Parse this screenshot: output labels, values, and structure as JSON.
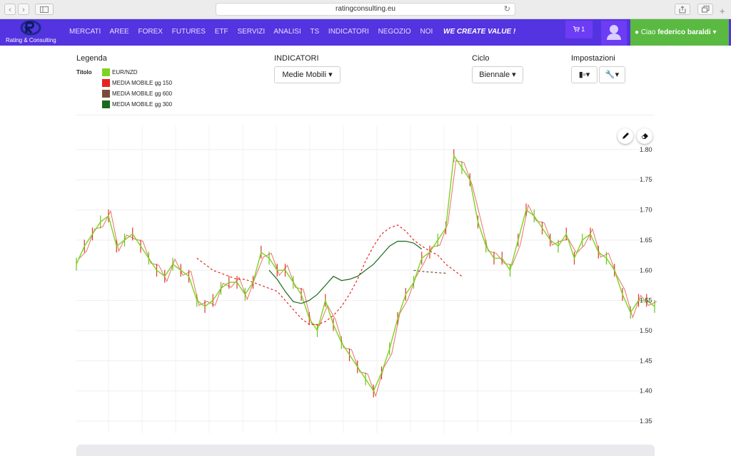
{
  "browser": {
    "url": "ratingconsulting.eu",
    "back_glyph": "‹",
    "forward_glyph": "›"
  },
  "nav": {
    "logo_text": "Rating & Consulting",
    "menu": [
      "MERCATI",
      "AREE",
      "FOREX",
      "FUTURES",
      "ETF",
      "SERVIZI",
      "ANALISI",
      "TS",
      "INDICATORI",
      "NEGOZIO",
      "NOI"
    ],
    "slogan": "WE CREATE VALUE !",
    "cart_count": "1",
    "user_greeting": "Ciao",
    "user_name": "federico baraldi",
    "brand_color": "#5433e0",
    "user_color": "#5ab941"
  },
  "controls": {
    "legenda_label": "Legenda",
    "titolo_label": "Titolo",
    "legend": [
      {
        "label": "EUR/NZD",
        "color": "#7ed321"
      },
      {
        "label": "MEDIA MOBILE gg 150",
        "color": "#e8231f"
      },
      {
        "label": "MEDIA MOBILE gg 600",
        "color": "#7b4b3a"
      },
      {
        "label": "MEDIA MOBILE gg 300",
        "color": "#1a6a1a"
      }
    ],
    "indicatori_label": "INDICATORI",
    "indicatori_value": "Medie Mobili",
    "ciclo_label": "Ciclo",
    "ciclo_value": "Biennale",
    "impostazioni_label": "Impostazioni"
  },
  "chart_data": {
    "type": "line",
    "yticks": [
      1.8,
      1.75,
      1.7,
      1.65,
      1.6,
      1.55,
      1.5,
      1.45,
      1.4,
      1.35
    ],
    "ylim": [
      1.33,
      1.84
    ],
    "grid": true,
    "series": [
      {
        "name": "EUR/NZD",
        "color": "#7ed321",
        "values": [
          1.61,
          1.64,
          1.66,
          1.68,
          1.69,
          1.64,
          1.65,
          1.66,
          1.64,
          1.62,
          1.6,
          1.59,
          1.61,
          1.6,
          1.59,
          1.55,
          1.54,
          1.55,
          1.57,
          1.58,
          1.58,
          1.56,
          1.58,
          1.63,
          1.62,
          1.6,
          1.6,
          1.58,
          1.56,
          1.52,
          1.5,
          1.55,
          1.51,
          1.48,
          1.46,
          1.44,
          1.42,
          1.4,
          1.43,
          1.47,
          1.52,
          1.56,
          1.58,
          1.62,
          1.63,
          1.65,
          1.67,
          1.79,
          1.77,
          1.75,
          1.68,
          1.64,
          1.62,
          1.62,
          1.6,
          1.65,
          1.7,
          1.69,
          1.67,
          1.65,
          1.64,
          1.66,
          1.62,
          1.65,
          1.66,
          1.63,
          1.62,
          1.6,
          1.56,
          1.53,
          1.55,
          1.55,
          1.54
        ]
      },
      {
        "name": "MEDIA MOBILE gg 150",
        "color": "#e8231f",
        "dashed": true,
        "values": [
          null,
          null,
          null,
          null,
          null,
          null,
          null,
          null,
          null,
          null,
          null,
          null,
          null,
          null,
          null,
          1.62,
          1.61,
          1.6,
          1.595,
          1.59,
          1.585,
          1.585,
          1.58,
          1.575,
          1.57,
          1.565,
          1.55,
          1.535,
          1.52,
          1.51,
          1.51,
          1.515,
          1.525,
          1.54,
          1.56,
          1.585,
          1.615,
          1.64,
          1.66,
          1.67,
          1.675,
          1.665,
          1.65,
          1.64,
          1.632,
          1.625,
          1.61,
          1.6,
          1.59
        ]
      },
      {
        "name": "MEDIA MOBILE gg 600",
        "color": "#7b4b3a",
        "dashed": true,
        "values": [
          null,
          null,
          null,
          null,
          null,
          null,
          null,
          null,
          null,
          null,
          null,
          null,
          null,
          null,
          null,
          null,
          null,
          null,
          null,
          null,
          null,
          null,
          null,
          null,
          null,
          null,
          null,
          null,
          null,
          null,
          null,
          null,
          null,
          null,
          null,
          null,
          null,
          null,
          null,
          null,
          null,
          null,
          1.6,
          1.598,
          1.597,
          1.596,
          1.595
        ]
      },
      {
        "name": "MEDIA MOBILE gg 300",
        "color": "#1a6a1a",
        "values": [
          null,
          null,
          null,
          null,
          null,
          null,
          null,
          null,
          null,
          null,
          null,
          null,
          null,
          null,
          null,
          null,
          null,
          null,
          null,
          null,
          null,
          null,
          null,
          null,
          1.6,
          1.585,
          1.565,
          1.548,
          1.545,
          1.55,
          1.56,
          1.575,
          1.59,
          1.583,
          1.585,
          1.59,
          1.6,
          1.61,
          1.625,
          1.64,
          1.648,
          1.648,
          1.645,
          1.635
        ]
      }
    ]
  }
}
